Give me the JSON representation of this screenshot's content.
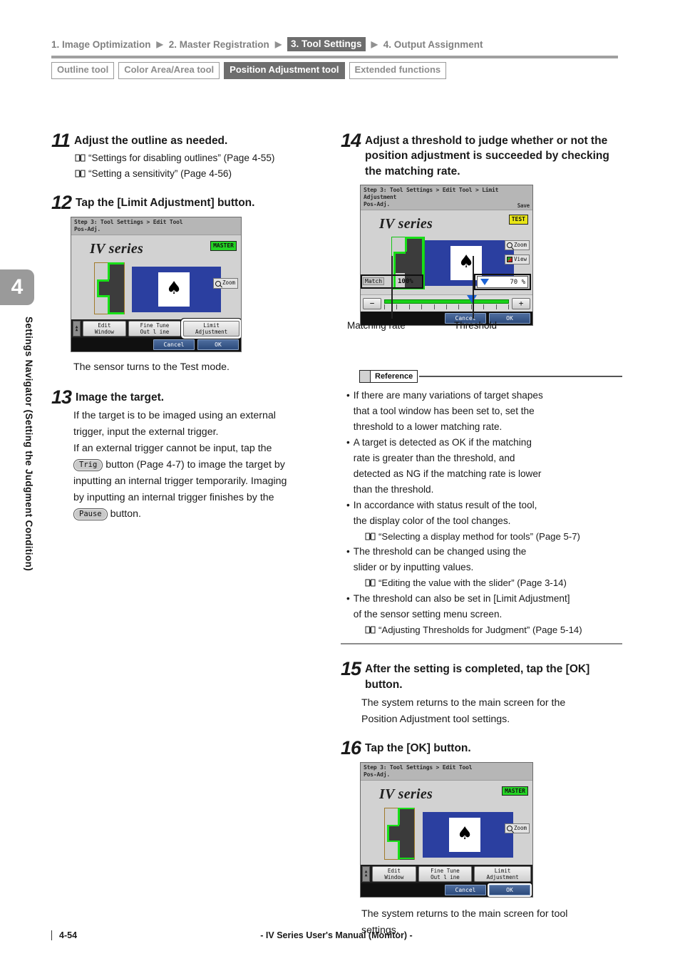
{
  "nav": {
    "items": [
      {
        "label": "1. Image Optimization",
        "active": false
      },
      {
        "label": "2. Master Registration",
        "active": false
      },
      {
        "label": "3. Tool Settings",
        "active": true
      },
      {
        "label": "4. Output Assignment",
        "active": false
      }
    ],
    "separator": "▶"
  },
  "toolbar": {
    "buttons": [
      {
        "label": "Outline tool",
        "active": false
      },
      {
        "label": "Color Area/Area tool",
        "active": false
      },
      {
        "label": "Position Adjustment tool",
        "active": true
      },
      {
        "label": "Extended functions",
        "active": false
      }
    ]
  },
  "side_tab": {
    "chapter": "4",
    "title": "Settings Navigator (Setting the Judgment Condition)"
  },
  "steps": {
    "s11": {
      "num": "11",
      "title": "Adjust the outline as needed.",
      "refs": [
        "“Settings for disabling outlines” (Page 4-55)",
        "“Setting a sensitivity” (Page 4-56)"
      ]
    },
    "s12": {
      "num": "12",
      "title": "Tap the [Limit Adjustment] button.",
      "after": "The sensor turns to the Test mode."
    },
    "s13": {
      "num": "13",
      "title": "Image the target.",
      "p1": "If the target is to be imaged using an external",
      "p2": "trigger, input the external trigger.",
      "p3": "If an external trigger cannot be input, tap the",
      "key_trig": "Trig",
      "p4": "button (Page 4-7) to image the target by",
      "p5": "inputting an internal trigger temporarily.  Imaging",
      "p6": "by inputting an internal trigger finishes by the",
      "key_pause": "Pause",
      "p7": "button."
    },
    "s14": {
      "num": "14",
      "title": "Adjust a threshold to judge whether or not the position adjustment is succeeded by checking the matching rate.",
      "callout_left": "Matching rate",
      "callout_right": "Threshold"
    },
    "s15": {
      "num": "15",
      "title": "After the setting is completed, tap the [OK] button.",
      "b1": "The system returns to the main screen for the",
      "b2": "Position Adjustment tool settings."
    },
    "s16": {
      "num": "16",
      "title": "Tap the [OK] button.",
      "b1": "The system returns to the main screen for tool",
      "b2": "settings."
    }
  },
  "reference": {
    "tag": "Reference",
    "bullets": [
      {
        "lines": [
          "If there are many variations of target shapes",
          "that a tool window has been set to, set the",
          "threshold to a lower matching rate."
        ],
        "sub": null
      },
      {
        "lines": [
          "A target is detected as OK if the matching",
          "rate is greater than the threshold, and",
          "detected as NG if the matching rate is lower",
          "than the threshold."
        ],
        "sub": null
      },
      {
        "lines": [
          "In accordance with status result of the tool,",
          "the display color of the tool changes."
        ],
        "sub": "“Selecting a display method for tools” (Page 5-7)"
      },
      {
        "lines": [
          "The threshold can be changed using the",
          "slider or by inputting values."
        ],
        "sub": "“Editing the value with the slider” (Page 3-14)"
      },
      {
        "lines": [
          "The threshold can also be set in [Limit Adjustment]",
          "of the sensor setting menu screen."
        ],
        "sub": "“Adjusting Thresholds for Judgment” (Page 5-14)"
      }
    ]
  },
  "device_12": {
    "title_line1": "Step 3: Tool Settings > Edit Tool",
    "title_line2": "Pos-Adj.",
    "logo": "IV series",
    "badge": "MASTER",
    "zoom_btn": "Zoom",
    "buttons": [
      {
        "l1": "Edit",
        "l2": "Window",
        "highlight": false
      },
      {
        "l1": "Fine Tune",
        "l2": "Out l ine",
        "highlight": false
      },
      {
        "l1": "Limit",
        "l2": "Adjustment",
        "highlight": true
      }
    ],
    "cancel": "Cancel",
    "ok": "OK"
  },
  "device_14": {
    "title_line1": "Step 3: Tool Settings > Edit Tool > Limit Adjustment",
    "title_line2": "Pos-Adj.",
    "save_label": "Save",
    "logo": "IV series",
    "badge": "TEST",
    "zoom_btn": "Zoom",
    "view_btn": "View",
    "match_label": "Match",
    "match_value": "100%",
    "threshold_value": "70 %",
    "minus": "−",
    "plus": "+",
    "slider_percent": 70,
    "cancel": "Cancel",
    "ok": "OK"
  },
  "device_16": {
    "title_line1": "Step 3: Tool Settings > Edit Tool",
    "title_line2": "Pos-Adj.",
    "logo": "IV series",
    "badge": "MASTER",
    "zoom_btn": "Zoom",
    "buttons": [
      {
        "l1": "Edit",
        "l2": "Window",
        "highlight": false
      },
      {
        "l1": "Fine Tune",
        "l2": "Out l ine",
        "highlight": false
      },
      {
        "l1": "Limit",
        "l2": "Adjustment",
        "highlight": false
      }
    ],
    "cancel": "Cancel",
    "ok": "OK",
    "ok_highlight": true
  },
  "footer": {
    "page": "4-54",
    "center": "- IV Series User's Manual (Monitor) -"
  },
  "colors": {
    "accent_gray": "#6e6e6e",
    "blue_panel": "#2b3fa0",
    "green_outline": "#19e019",
    "master_green": "#25d425",
    "test_yellow": "#e8e516"
  }
}
